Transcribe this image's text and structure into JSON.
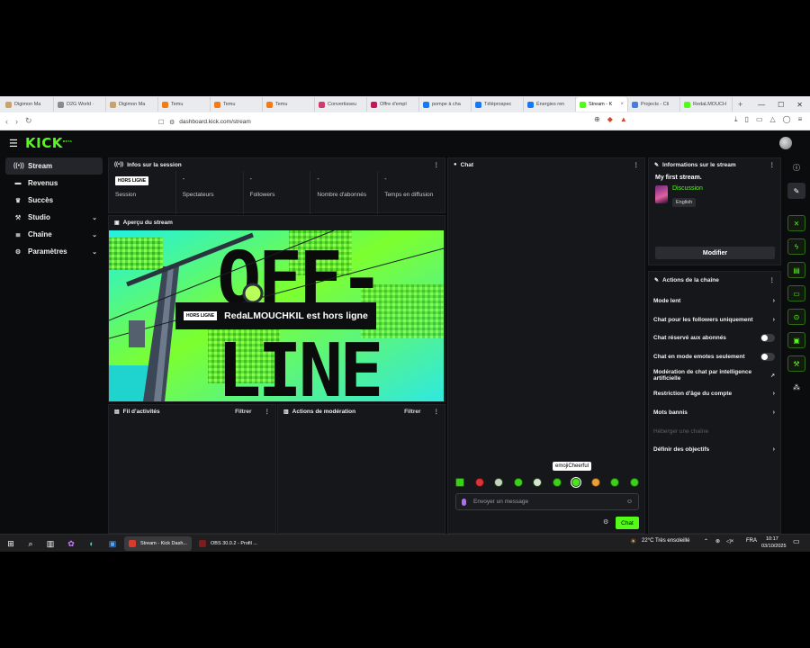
{
  "browser": {
    "tabs": [
      {
        "label": "Digimon Ma",
        "color": "#c9a36b"
      },
      {
        "label": "D2G World ·",
        "color": "#8a8a8a"
      },
      {
        "label": "Digimon Ma",
        "color": "#c9a36b"
      },
      {
        "label": "Temu",
        "color": "#f27a1a"
      },
      {
        "label": "Temu",
        "color": "#f27a1a"
      },
      {
        "label": "Temu",
        "color": "#f27a1a"
      },
      {
        "label": "Convertisseu",
        "color": "#d13b6a"
      },
      {
        "label": "Offre d'empl",
        "color": "#c2185b"
      },
      {
        "label": "pompe à cha",
        "color": "#1877f2"
      },
      {
        "label": "Téléprospec",
        "color": "#1877f2"
      },
      {
        "label": "Énergies ren",
        "color": "#1877f2"
      },
      {
        "label": "Stream - K",
        "color": "#53fc18"
      },
      {
        "label": "Projects - Cli",
        "color": "#4a7bd8"
      },
      {
        "label": "RedaLMOUCH",
        "color": "#53fc18"
      }
    ],
    "new_tab": "+",
    "url": "dashboard.kick.com/stream"
  },
  "kick": {
    "logo": "KICK",
    "logo_sup": "BETA",
    "sidebar": [
      {
        "label": "Stream",
        "icon": "broadcast-icon",
        "glyph": "((•))",
        "active": true
      },
      {
        "label": "Revenus",
        "icon": "wallet-icon",
        "glyph": "▬"
      },
      {
        "label": "Succès",
        "icon": "trophy-icon",
        "glyph": "♛"
      },
      {
        "label": "Studio",
        "icon": "studio-icon",
        "glyph": "⚒",
        "chevron": "⌄"
      },
      {
        "label": "Chaîne",
        "icon": "list-icon",
        "glyph": "≣",
        "chevron": "⌄"
      },
      {
        "label": "Paramètres",
        "icon": "gear-icon",
        "glyph": "⚙",
        "chevron": "⌄"
      }
    ],
    "session": {
      "title": "Infos sur la session",
      "badge": "HORS LIGNE",
      "stats": [
        {
          "value": "",
          "label": "Session"
        },
        {
          "value": "-",
          "label": "Spectateurs"
        },
        {
          "value": "-",
          "label": "Followers"
        },
        {
          "value": "-",
          "label": "Nombre d'abonnés"
        },
        {
          "value": "-",
          "label": "Temps en diffusion"
        }
      ]
    },
    "preview": {
      "title": "Aperçu du stream",
      "offline_line1": "OFF-",
      "offline_line2": "LINE",
      "badge": "HORS LIGNE",
      "caption": "RedaLMOUCHKIL est hors ligne"
    },
    "activity": {
      "title": "Fil d'activités",
      "filter": "Filtrer"
    },
    "moderation": {
      "title": "Actions de modération",
      "filter": "Filtrer"
    },
    "chat": {
      "title": "Chat",
      "tooltip": "emojiCheerful",
      "placeholder": "Envoyer un message",
      "send": "Chat"
    },
    "stream_info": {
      "title": "Informations sur le stream",
      "stream_title": "My first stream.",
      "category": "Discussion",
      "language": "English",
      "edit": "Modifier"
    },
    "channel_actions": {
      "title": "Actions de la chaîne",
      "items": [
        {
          "label": "Mode lent",
          "control": "chevron"
        },
        {
          "label": "Chat pour les followers uniquement",
          "control": "chevron"
        },
        {
          "label": "Chat réservé aux abonnés",
          "control": "toggle"
        },
        {
          "label": "Chat en mode emotes seulement",
          "control": "toggle"
        },
        {
          "label": "Modération de chat par intelligence artificielle",
          "control": "external"
        },
        {
          "label": "Restriction d'âge du compte",
          "control": "chevron"
        },
        {
          "label": "Mots bannis",
          "control": "chevron"
        },
        {
          "label": "Héberger une chaîne",
          "control": "none",
          "disabled": true
        },
        {
          "label": "Définir des objectifs",
          "control": "chevron"
        }
      ]
    }
  },
  "taskbar": {
    "tasks": [
      {
        "label": "Stream - Kick Dash...",
        "color": "#d93a2b",
        "active": true
      },
      {
        "label": "OBS 30.0.2 - Profil ...",
        "color": "#7b1d1d"
      }
    ],
    "weather": "22°C  Très ensoleillé",
    "lang": "FRA",
    "time": "10:17",
    "date": "03/10/2025"
  }
}
